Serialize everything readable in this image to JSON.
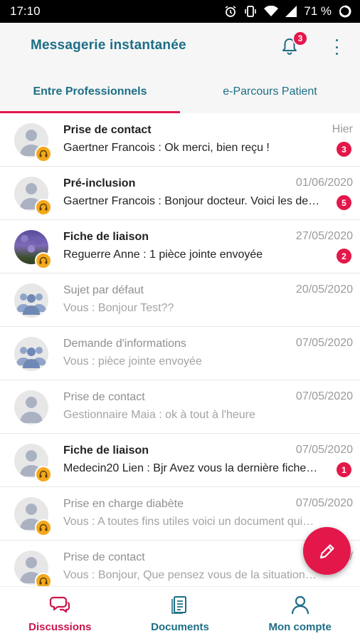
{
  "status_bar": {
    "time": "17:10",
    "battery": "71 %"
  },
  "app": {
    "title": "Messagerie instantanée",
    "notification_count": "3",
    "colors": {
      "primary": "#1d6e86",
      "accent": "#e3174a",
      "badge_orange": "#f3a81b"
    }
  },
  "tabs": [
    {
      "label": "Entre Professionnels",
      "active": true
    },
    {
      "label": "e-Parcours Patient",
      "active": false
    }
  ],
  "conversations": [
    {
      "title": "Prise de contact",
      "date": "Hier",
      "message": "Gaertner Francois : Ok merci, bien reçu !",
      "unread": "3",
      "avatar": "person-icon"
    },
    {
      "title": "Pré-inclusion",
      "date": "01/06/2020",
      "message": "Gaertner Francois : Bonjour docteur. Voici les de…",
      "unread": "5",
      "avatar": "person-icon"
    },
    {
      "title": "Fiche de liaison",
      "date": "27/05/2020",
      "message": "Reguerre Anne : 1 pièce jointe envoyée",
      "unread": "2",
      "avatar": "photo"
    },
    {
      "title": "Sujet par défaut",
      "date": "20/05/2020",
      "message": "Vous : Bonjour Test??",
      "unread": "",
      "avatar": "group-icon"
    },
    {
      "title": "Demande d'informations",
      "date": "07/05/2020",
      "message": "Vous : pièce jointe envoyée",
      "unread": "",
      "avatar": "group-icon"
    },
    {
      "title": "Prise de contact",
      "date": "07/05/2020",
      "message": "Gestionnaire Maia : ok à tout à l'heure",
      "unread": "",
      "avatar": "person-icon"
    },
    {
      "title": "Fiche de liaison",
      "date": "07/05/2020",
      "message": "Medecin20 Lien : Bjr  Avez vous la dernière fiche…",
      "unread": "1",
      "avatar": "person-icon"
    },
    {
      "title": "Prise en charge diabète",
      "date": "07/05/2020",
      "message": "Vous : A toutes fins utiles voici un document qui…",
      "unread": "",
      "avatar": "person-icon"
    },
    {
      "title": "Prise de contact",
      "date": "05/",
      "message": "Vous : Bonjour, Que pensez vous de la situation…",
      "unread": "",
      "avatar": "person-icon"
    }
  ],
  "bottom_nav": [
    {
      "label": "Discussions",
      "icon": "chat-bubbles-icon",
      "active": true
    },
    {
      "label": "Documents",
      "icon": "document-icon",
      "active": false
    },
    {
      "label": "Mon compte",
      "icon": "account-icon",
      "active": false
    }
  ]
}
